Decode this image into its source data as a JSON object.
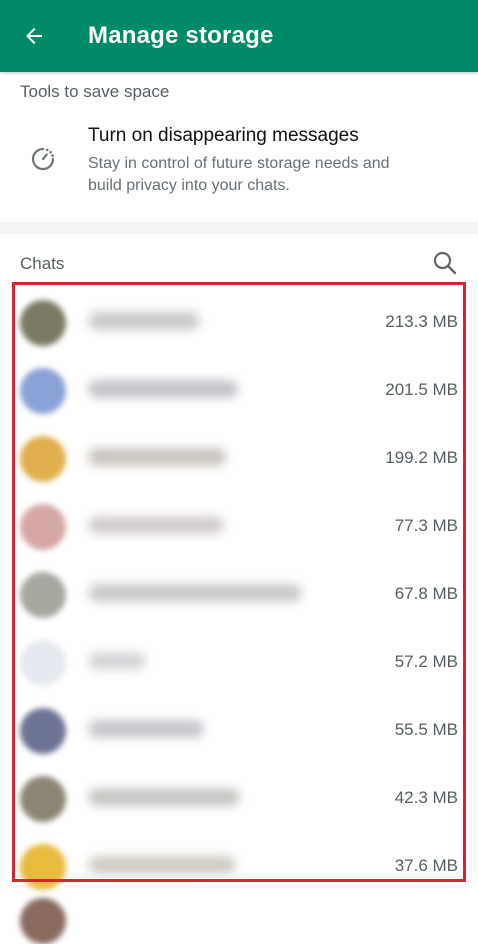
{
  "header": {
    "title": "Manage storage",
    "back_icon": "arrow-left-icon"
  },
  "tools": {
    "section_label": "Tools to save space",
    "items": [
      {
        "icon": "disappearing-timer-icon",
        "title": "Turn on disappearing messages",
        "description": "Stay in control of future storage needs and build privacy into your chats."
      }
    ]
  },
  "chats": {
    "section_label": "Chats",
    "search_icon": "search-icon",
    "items": [
      {
        "size": "213.3 MB",
        "avatar_color": "#7a7a62",
        "name_bar_color": "#b8b8b8"
      },
      {
        "size": "201.5 MB",
        "avatar_color": "#8aa2d6",
        "name_bar_color": "#b0b0b8"
      },
      {
        "size": "199.2 MB",
        "avatar_color": "#e0b04c",
        "name_bar_color": "#b8b0a8"
      },
      {
        "size": "77.3 MB",
        "avatar_color": "#d5a8a6",
        "name_bar_color": "#c4bcbc"
      },
      {
        "size": "67.8 MB",
        "avatar_color": "#a7a8a0",
        "name_bar_color": "#b8b8b8"
      },
      {
        "size": "57.2 MB",
        "avatar_color": "#e5e8ee",
        "name_bar_color": "#c8c8cc"
      },
      {
        "size": "55.5 MB",
        "avatar_color": "#6d7395",
        "name_bar_color": "#b4b4bc"
      },
      {
        "size": "42.3 MB",
        "avatar_color": "#8d8674",
        "name_bar_color": "#b6b4b0"
      },
      {
        "size": "37.6 MB",
        "avatar_color": "#e6bb3e",
        "name_bar_color": "#c0bcb0"
      }
    ]
  },
  "highlight_color": "#d4262b",
  "brand_color": "#008a68"
}
